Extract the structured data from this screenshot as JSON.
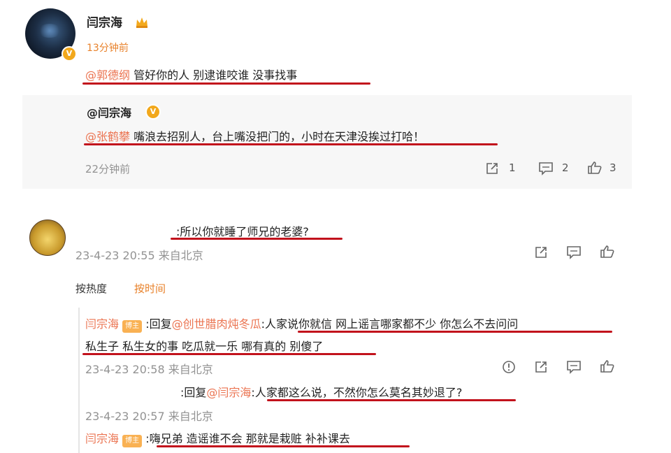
{
  "comment1": {
    "username": "闫宗海",
    "time": "13分钟前",
    "mention": "@郭德纲",
    "text": " 管好你的人 别逮谁咬谁 没事找事"
  },
  "quoted": {
    "author": "@闫宗海",
    "mention": "@张鹤攀",
    "text": " 嘴浪去招别人，台上嘴没把门的，小时在天津没挨过打哈！",
    "time": "22分钟前",
    "share_count": "1",
    "comment_count": "2",
    "like_count": "3"
  },
  "comment2": {
    "text": ":所以你就睡了师兄的老婆?",
    "meta": "23-4-23 20:55 来自北京"
  },
  "sort_tabs": {
    "hot": "按热度",
    "time": "按时间"
  },
  "replies": [
    {
      "username": "闫宗海",
      "tag": "博主",
      "prefix": ":回复",
      "mention": "@创世腊肉炖冬瓜",
      "text_line1": ":人家说你就信 网上谣言哪家都不少 你怎么不去问问",
      "text_line2": "私生子 私生女的事 吃瓜就一乐 哪有真的 别傻了",
      "meta": "23-4-23 20:58 来自北京"
    },
    {
      "prefix": ":回复",
      "mention": "@闫宗海",
      "text": ":人家都这么说，不然你怎么莫名其妙退了?",
      "meta": "23-4-23 20:57 来自北京"
    },
    {
      "username": "闫宗海",
      "tag": "博主",
      "text": ":嗨兄弟 造谣谁不会 那就是栽赃 补补课去"
    }
  ],
  "colors": {
    "mention": "#eb7350",
    "underline": "#c2121c",
    "orange_time": "#e8812a",
    "tag_bg": "#f9b153"
  }
}
